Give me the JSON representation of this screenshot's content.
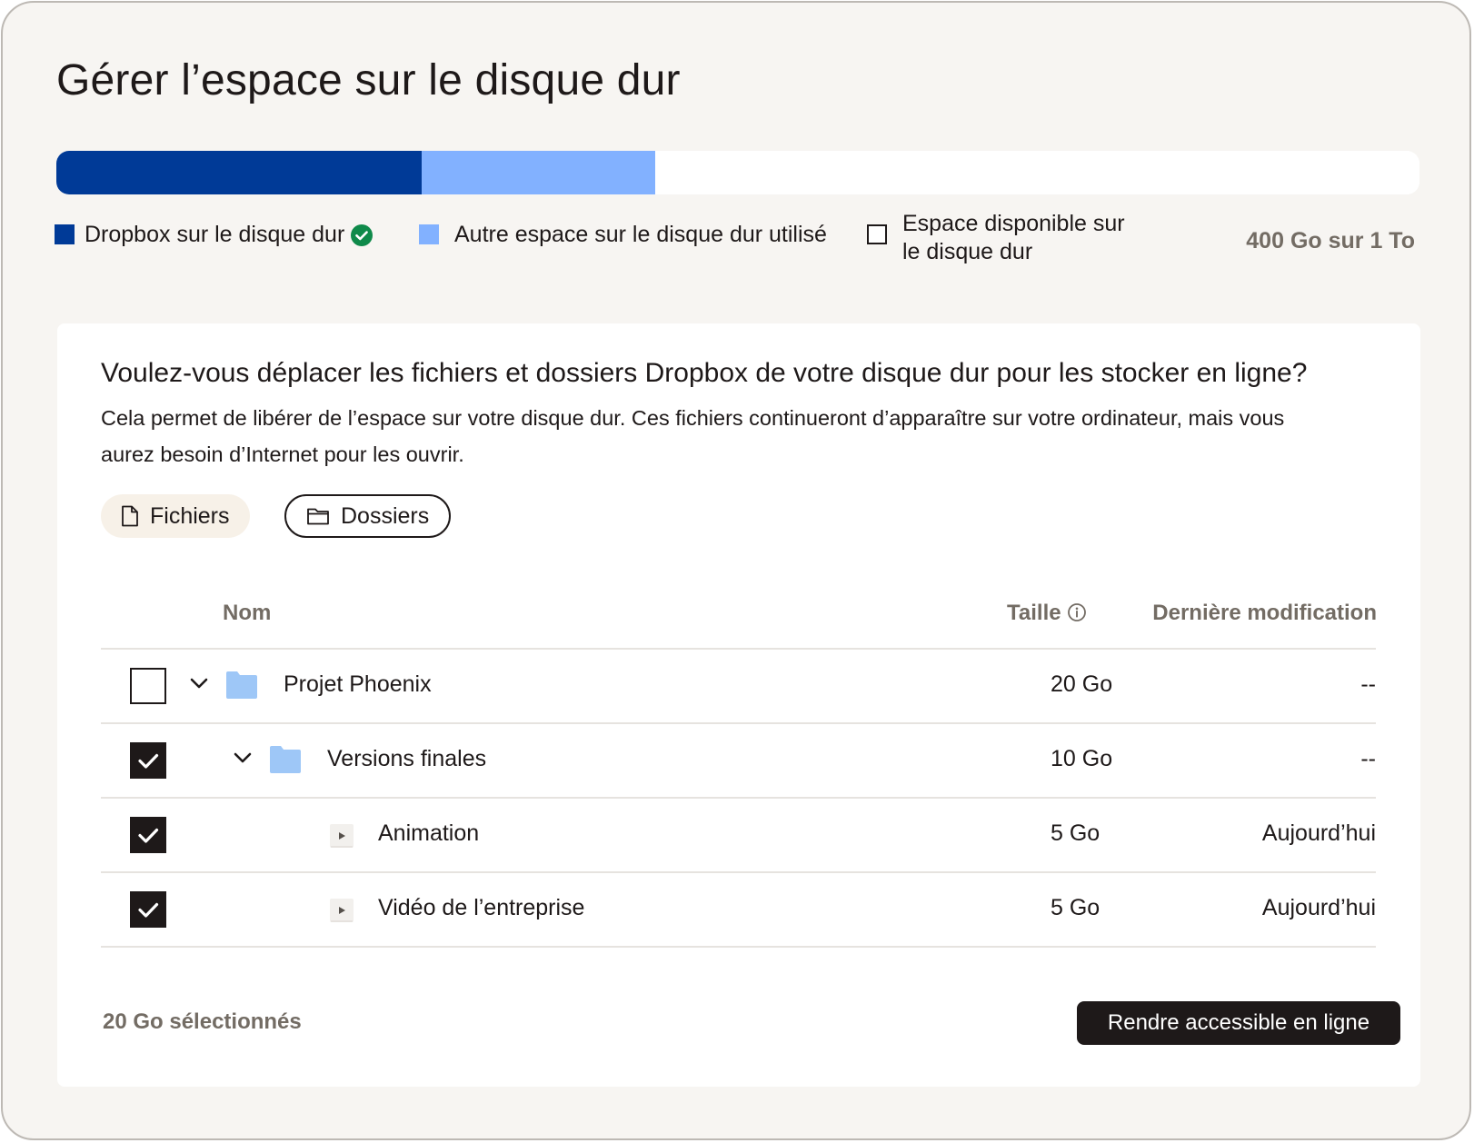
{
  "title": "Gérer l’espace sur le disque dur",
  "storage": {
    "segments": [
      {
        "key": "dropbox",
        "fraction": 0.268,
        "color": "#003a97"
      },
      {
        "key": "other",
        "fraction": 0.171,
        "color": "#82b1ff"
      },
      {
        "key": "free",
        "fraction": 0.561,
        "color": "#ffffff"
      }
    ],
    "legend": {
      "dropbox": "Dropbox sur le disque dur",
      "other": "Autre espace sur le disque dur utilisé",
      "free_line1": "Espace disponible sur",
      "free_line2": "le disque dur"
    },
    "total": "400 Go sur 1 To",
    "status_color": "#0f8a4a"
  },
  "panel": {
    "question": "Voulez-vous déplacer les fichiers et dossiers Dropbox de votre disque dur pour les stocker en ligne?",
    "description": "Cela permet de libérer de l’espace sur votre disque dur. Ces fichiers continueront d’apparaître sur votre ordinateur, mais vous aurez besoin d’Internet pour les ouvrir.",
    "tabs": {
      "files": "Fichiers",
      "folders": "Dossiers",
      "active": "folders"
    }
  },
  "table": {
    "headers": {
      "name": "Nom",
      "size": "Taille",
      "modified": "Dernière modification"
    },
    "rows": [
      {
        "name": "Projet Phoenix",
        "size": "20 Go",
        "modified": "--",
        "checked": false,
        "expander": "chevron-down",
        "icon": "folder-icon"
      },
      {
        "name": "Versions finales",
        "size": "10 Go",
        "modified": "--",
        "checked": true,
        "expander": "chevron-down",
        "icon": "folder-icon"
      },
      {
        "name": "Animation",
        "size": "5 Go",
        "modified": "Aujourd’hui",
        "checked": true,
        "expander": "play-file"
      },
      {
        "name": "Vidéo de l’entreprise",
        "size": "5 Go",
        "modified": "Aujourd’hui",
        "checked": true,
        "expander": "play-file"
      }
    ]
  },
  "footer": {
    "selected": "20 Go sélectionnés",
    "cta": "Rendre accessible en ligne"
  },
  "colors": {
    "folder": "#9ec7f7",
    "accent": "#1e1919",
    "muted": "#736c64"
  }
}
